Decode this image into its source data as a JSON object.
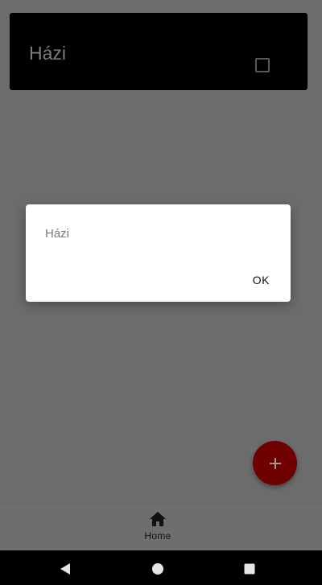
{
  "task_list": {
    "items": [
      {
        "title": "Házi",
        "checked": false
      }
    ]
  },
  "fab": {
    "icon": "plus-icon"
  },
  "bottom_nav": {
    "items": [
      {
        "label": "Home",
        "icon": "home-icon",
        "selected": true
      }
    ]
  },
  "dialog": {
    "message": "Házi",
    "ok_label": "OK"
  },
  "system_nav": {
    "back_icon": "back-triangle-icon",
    "home_icon": "home-circle-icon",
    "recents_icon": "recents-square-icon"
  },
  "colors": {
    "fab": "#8b0000",
    "card": "#000000",
    "scrim": "#6c6c6c",
    "dialog": "#ffffff"
  }
}
